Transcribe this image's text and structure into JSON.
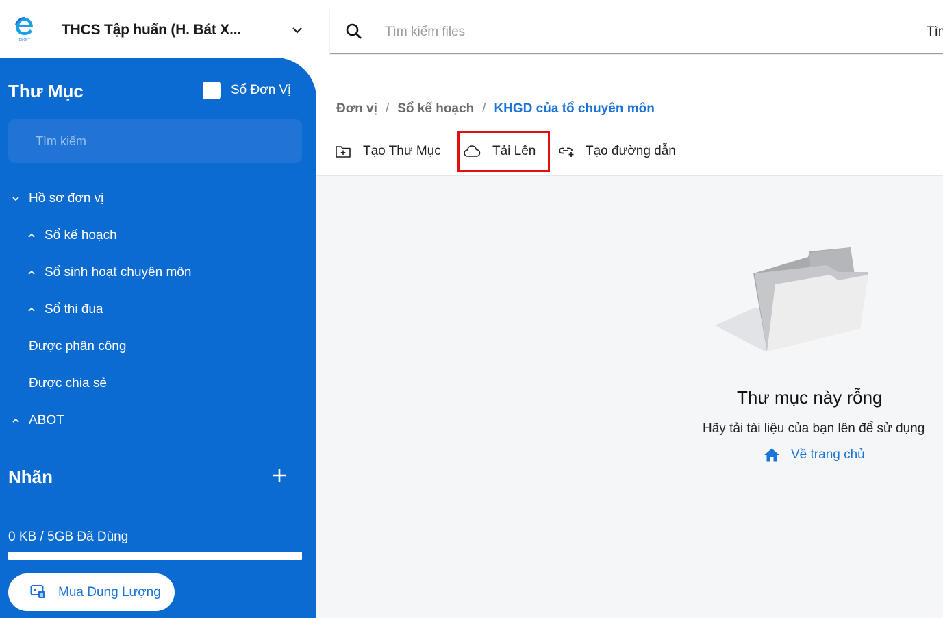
{
  "header": {
    "org_name": "THCS Tập huấn (H. Bát X..."
  },
  "sidebar": {
    "title": "Thư Mục",
    "unit_checkbox_label": "Sổ Đơn Vị",
    "search_placeholder": "Tìm kiếm",
    "tree": [
      {
        "label": "Hồ sơ đơn vị",
        "arrow": "chevron-down"
      },
      {
        "label": "Sổ kế hoạch",
        "arrow": "chevron-up"
      },
      {
        "label": "Sổ sinh hoạt chuyên môn",
        "arrow": "chevron-up"
      },
      {
        "label": "Sổ thi đua",
        "arrow": "chevron-up"
      },
      {
        "label": "Được phân công",
        "arrow": "none"
      },
      {
        "label": "Được chia sẻ",
        "arrow": "none"
      },
      {
        "label": "ABOT",
        "arrow": "chevron-up"
      }
    ],
    "labels_title": "Nhãn",
    "storage_text": "0 KB / 5GB Đã Dùng",
    "storage_used_fraction": 0,
    "buy_button": "Mua Dung Lượng"
  },
  "topbar": {
    "search_placeholder": "Tìm kiếm files",
    "right_text": "Tìm"
  },
  "breadcrumb": [
    "Đơn vị",
    "Sổ kế hoạch",
    "KHGD của tổ chuyên môn"
  ],
  "toolbar": {
    "create_folder": "Tạo Thư Mục",
    "upload": "Tải Lên",
    "create_link": "Tạo đường dẫn"
  },
  "empty_state": {
    "title": "Thư mục này rỗng",
    "description": "Hãy tải tài liệu của bạn lên để sử dụng",
    "home_link": "Về trang chủ"
  },
  "colors": {
    "sidebar_bg": "#0b6bd1",
    "accent": "#1a73d9",
    "highlight": "#e01010",
    "content_bg": "#f5f6f8"
  }
}
